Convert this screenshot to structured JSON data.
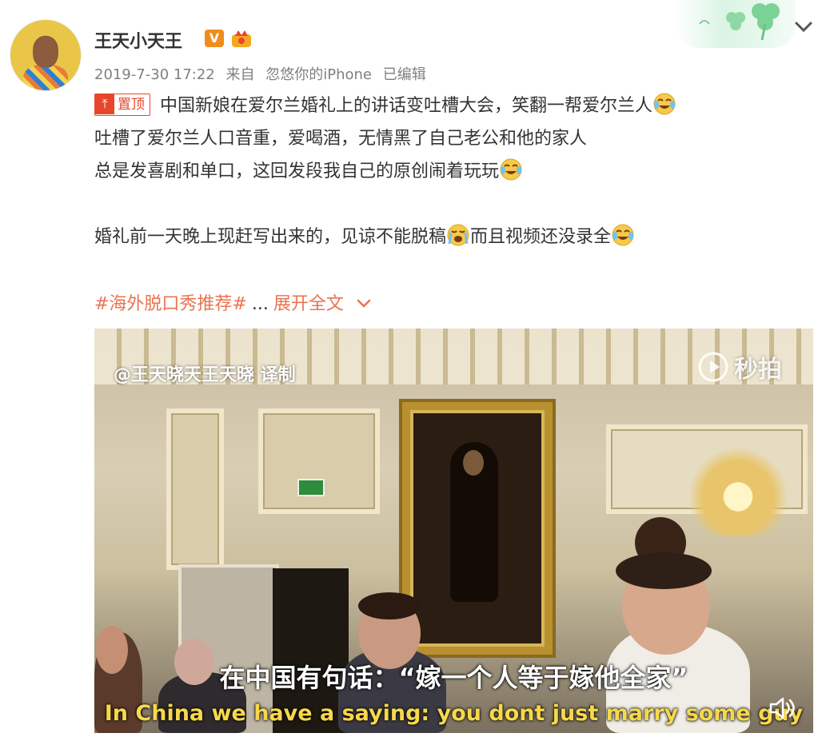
{
  "user": {
    "name": "王天小天王",
    "verified_badge": "V",
    "crown_icon": "crown-badge-icon"
  },
  "meta": {
    "date": "2019-7-30 17:22",
    "source_prefix": "来自",
    "source": "忽悠你的iPhone",
    "edited": "已编辑"
  },
  "post": {
    "pin_label": "置顶",
    "line1": "中国新娘在爱尔兰婚礼上的讲话变吐槽大会，笑翻一帮爱尔兰人",
    "line2": "吐槽了爱尔兰人口音重，爱喝酒，无情黑了自己老公和他的家人",
    "line3": "总是发喜剧和单口，这回发段我自己的原创闹着玩玩",
    "line4_a": "婚礼前一天晚上现赶写出来的，见谅不能脱稿",
    "line4_b": "而且视频还没录全",
    "hashtag": "#海外脱口秀推荐#",
    "ellipsis": "...",
    "expand_label": "展开全文"
  },
  "video": {
    "watermark": "@王天晓天王天晓 译制",
    "brand": "秒拍",
    "subtitle_cn": "在中国有句话：“嫁一个人等于嫁他全家”",
    "subtitle_en": "In China we have a saying: you dont just marry some guy"
  },
  "colors": {
    "accent_orange": "#eb7350",
    "pin_red": "#e8462b",
    "text_main": "#333333",
    "text_meta": "#808080",
    "verified": "#f08c1b",
    "subtitle_en": "#f7d84a"
  }
}
